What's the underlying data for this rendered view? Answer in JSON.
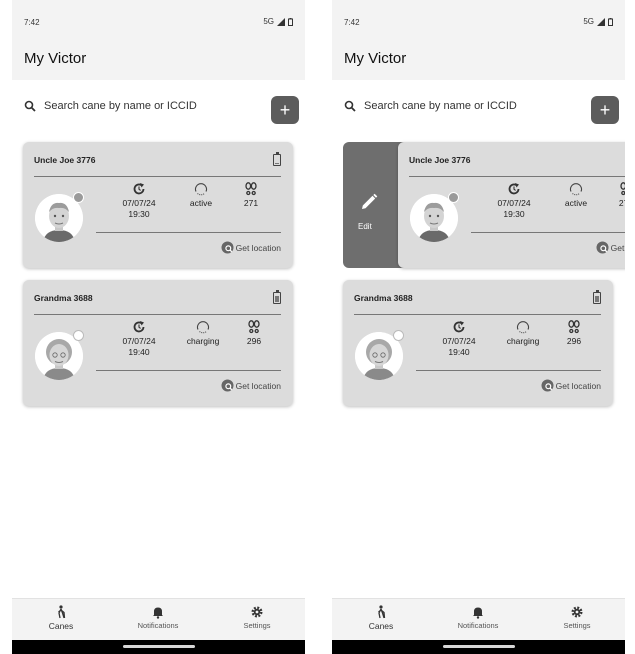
{
  "status_bar": {
    "time": "7:42",
    "network": "5G"
  },
  "app": {
    "title": "My Victor"
  },
  "search": {
    "placeholder": "Search cane by name or ICCID",
    "add_label": "+"
  },
  "canes": [
    {
      "name": "Uncle Joe 3776",
      "date": "07/07/24",
      "time": "19:30",
      "status": "active",
      "steps": "271",
      "dot_color": "#9a9a9a",
      "battery_level": 0.1,
      "get_location": "Get location"
    },
    {
      "name": "Grandma 3688",
      "date": "07/07/24",
      "time": "19:40",
      "status": "charging",
      "steps": "296",
      "dot_color": "#ffffff",
      "battery_level": 0.6,
      "get_location": "Get location"
    }
  ],
  "swipe_action": {
    "label": "Edit"
  },
  "nav": {
    "items": [
      {
        "label": "Canes",
        "icon": "walking-person-icon"
      },
      {
        "label": "Notifications",
        "icon": "bell-icon"
      },
      {
        "label": "Settings",
        "icon": "gear-icon"
      }
    ]
  },
  "colors": {
    "card": "#dcdcdc",
    "accent": "#5c5c5c",
    "edit": "#6e6e6e"
  }
}
